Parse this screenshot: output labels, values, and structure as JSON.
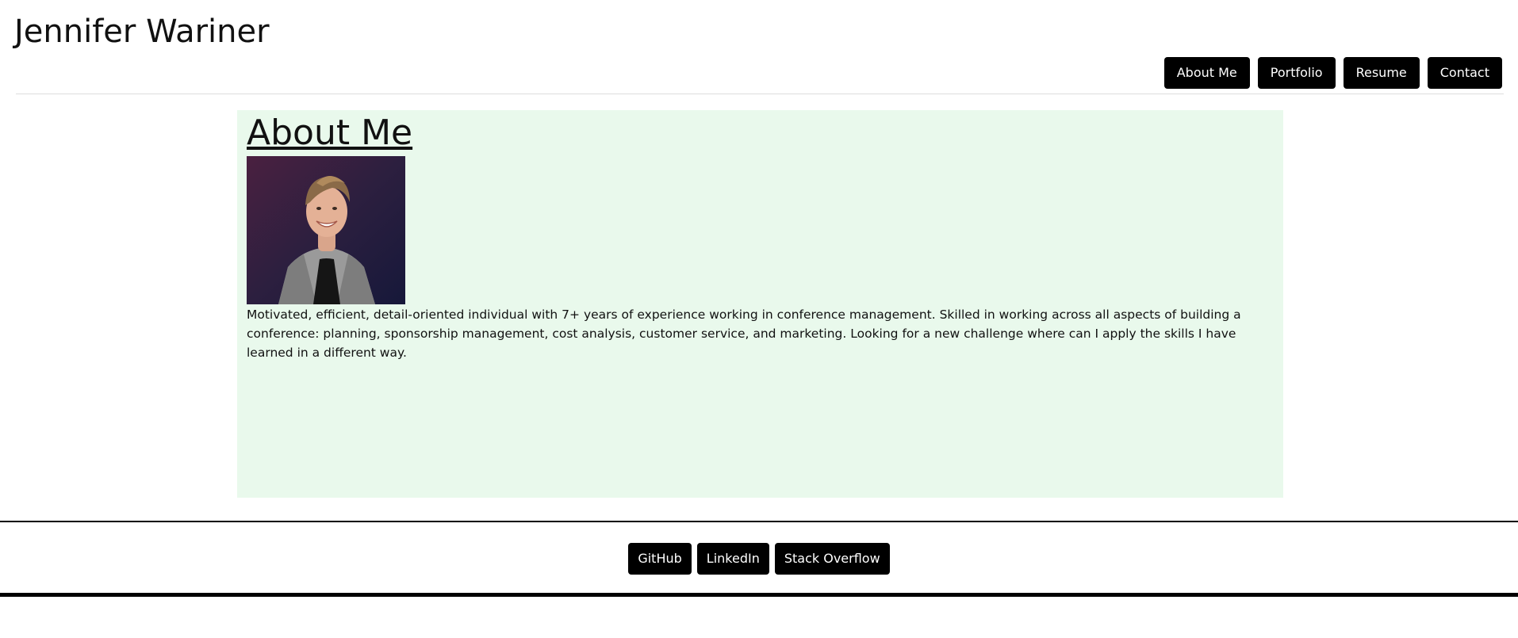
{
  "header": {
    "title": "Jennifer Wariner",
    "nav": [
      "About Me",
      "Portfolio",
      "Resume",
      "Contact"
    ]
  },
  "main": {
    "heading": "About Me",
    "bio": "Motivated, efficient, detail-oriented individual with 7+ years of experience working in conference management. Skilled in working across all aspects of building a conference: planning, sponsorship management, cost analysis, customer service, and marketing. Looking for a new challenge where can I apply the skills I have learned in a different way.",
    "background_color": "#e9f9ec"
  },
  "footer": {
    "links": [
      "GitHub",
      "LinkedIn",
      "Stack Overflow"
    ]
  },
  "colors": {
    "button_bg": "#000000",
    "button_text": "#ffffff"
  }
}
